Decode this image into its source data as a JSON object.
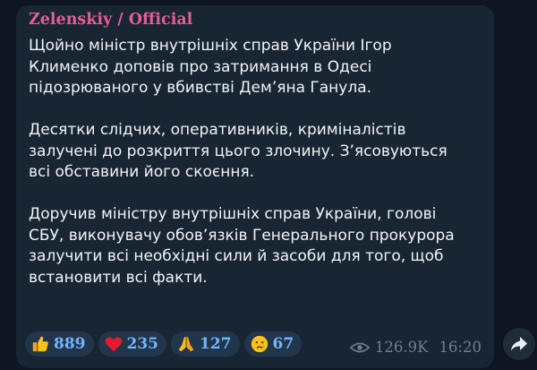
{
  "message": {
    "channel_name": "Zelenskiy / Official",
    "paragraphs": [
      {
        "lines": [
          "Щойно міністр внутрішніх справ України Ігор",
          "Клименко доповів про затримання в Одесі",
          "підозрюваного у вбивстві Дем’яна Ганула."
        ]
      },
      {
        "lines": [
          "Десятки слідчих, оперативників, криміналістів",
          "залучені до розкриття цього злочину. З’ясовуються",
          "всі обставини його скоєння."
        ]
      },
      {
        "lines": [
          "Доручив міністру внутрішніх справ України, голові",
          "СБУ, виконувачу обов’язків Генерального прокурора",
          "залучити всі необхідні сили й засоби для того, щоб",
          "встановити всі факти."
        ]
      }
    ],
    "reactions": [
      {
        "icon": "thumbs-up-icon",
        "count": "889"
      },
      {
        "icon": "red-heart-icon",
        "count": "235"
      },
      {
        "icon": "folded-hands-icon",
        "count": "127"
      },
      {
        "icon": "crying-face-icon",
        "count": "67"
      }
    ],
    "views": "126.9K",
    "time": "16:20",
    "share_icon": "share-arrow-icon"
  },
  "colors": {
    "background": "#0e1621",
    "bubble": "#182533",
    "channel_name": "#e45e94",
    "text": "#f2f4f6",
    "reaction_bg": "#22364b",
    "reaction_count": "#6fb6ff",
    "meta": "#6d7f8f"
  }
}
